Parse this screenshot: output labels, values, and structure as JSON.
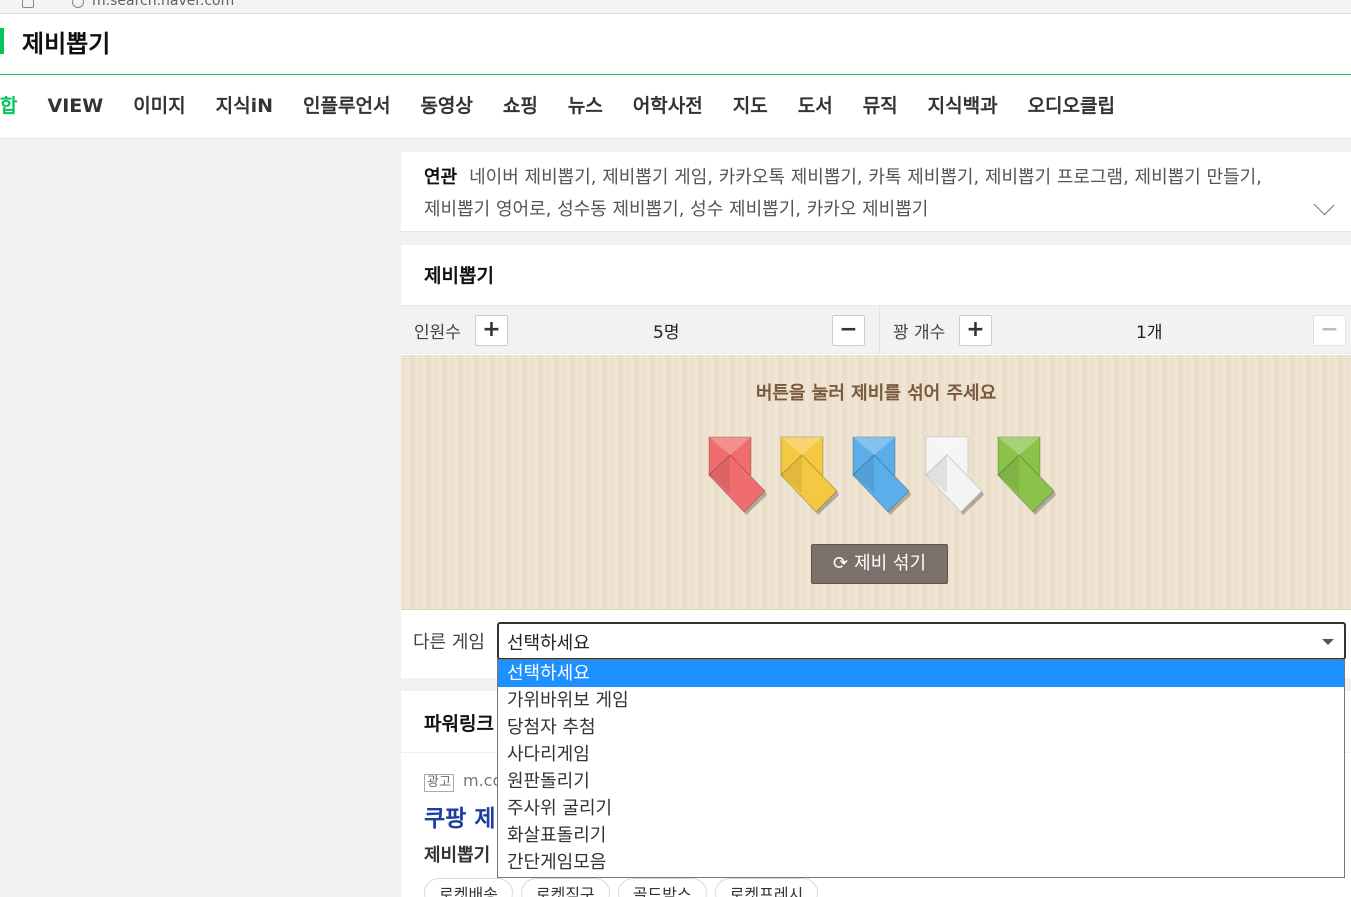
{
  "browser": {
    "url_text": "m.search.naver.com"
  },
  "header": {
    "query": "제비뽑기",
    "tabs": [
      {
        "label": "합",
        "active": true
      },
      {
        "label": "VIEW"
      },
      {
        "label": "이미지"
      },
      {
        "label": "지식iN"
      },
      {
        "label": "인플루언서"
      },
      {
        "label": "동영상"
      },
      {
        "label": "쇼핑"
      },
      {
        "label": "뉴스"
      },
      {
        "label": "어학사전"
      },
      {
        "label": "지도"
      },
      {
        "label": "도서"
      },
      {
        "label": "뮤직"
      },
      {
        "label": "지식백과"
      },
      {
        "label": "오디오클립"
      }
    ]
  },
  "related": {
    "label": "연관",
    "line1": "네이버 제비뽑기, 제비뽑기 게임, 카카오톡 제비뽑기, 카톡 제비뽑기, 제비뽑기 프로그램, 제비뽑기 만들기,",
    "line2": "제비뽑기 영어로, 성수동 제비뽑기, 성수 제비뽑기, 카카오 제비뽑기"
  },
  "game": {
    "title": "제비뽑기",
    "people_label": "인원수",
    "people_value": "5명",
    "blank_label": "꽝 개수",
    "blank_value": "1개",
    "plus": "+",
    "minus": "−",
    "message": "버튼을 눌러 제비를 섞어 주세요",
    "shuffle_label": "제비 섞기",
    "stick_colors": [
      "#ef6d6d",
      "#f5c842",
      "#5aaeea",
      "#f4f4f4",
      "#8bc34a"
    ],
    "other_label": "다른 게임",
    "select_value": "선택하세요"
  },
  "dropdown": {
    "options": [
      "선택하세요",
      "가위바위보 게임",
      "당첨자 추첨",
      "사다리게임",
      "원판돌리기",
      "주사위 굴리기",
      "화살표돌리기",
      "간단게임모음"
    ]
  },
  "power": {
    "title": "파워링크",
    "ad_badge": "광고",
    "ad_url": "m.co",
    "ad_title": "쿠팡 제",
    "ad_sub": "제비뽑기",
    "chips": [
      "로켓배송",
      "로켓직구",
      "골드박스",
      "로켓프레시"
    ]
  }
}
